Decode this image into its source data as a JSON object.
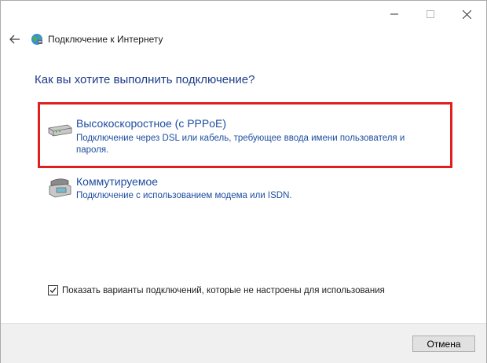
{
  "window": {
    "title": "Подключение к Интернету",
    "controls": [
      "minimize-icon",
      "maximize-icon",
      "close-icon"
    ]
  },
  "nav": {
    "back_icon": "back-arrow-icon",
    "app_icon": "network-globe-icon"
  },
  "main": {
    "heading": "Как вы хотите выполнить подключение?",
    "options": [
      {
        "icon": "broadband-modem-icon",
        "title": "Высокоскоростное (с PPPoE)",
        "description": "Подключение через DSL или кабель, требующее ввода имени пользователя и пароля.",
        "highlighted": true
      },
      {
        "icon": "dialup-phone-icon",
        "title": "Коммутируемое",
        "description": "Подключение с использованием модема или ISDN.",
        "highlighted": false
      }
    ],
    "show_unconfigured": {
      "checked": true,
      "label": "Показать варианты подключений, которые не настроены для использования"
    }
  },
  "footer": {
    "cancel_label": "Отмена"
  },
  "colors": {
    "link_blue": "#1e4da0",
    "heading_blue": "#1f3c8a",
    "highlight_red": "#e02020"
  }
}
